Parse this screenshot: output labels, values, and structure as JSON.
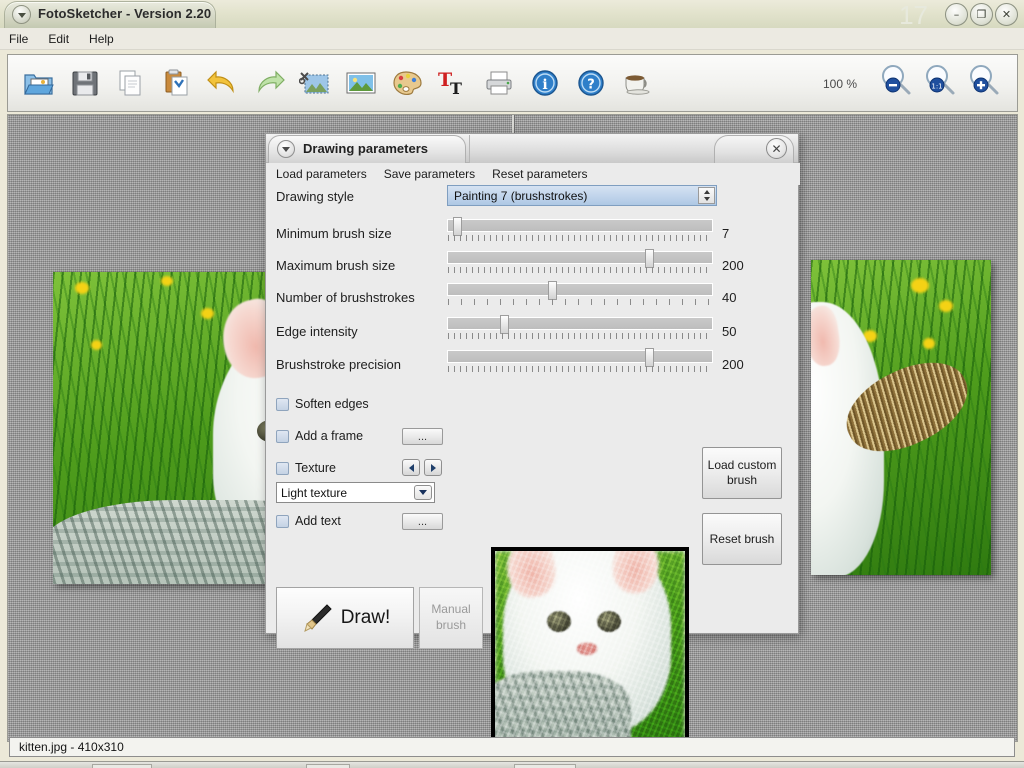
{
  "window": {
    "title": "FotoSketcher - Version 2.20",
    "bg_window_number": "17",
    "controls": {
      "minimize": "–",
      "maximize": "❐",
      "close": "✕"
    },
    "dropdown_icon": "chevron-down-icon"
  },
  "menubar": {
    "items": [
      "File",
      "Edit",
      "Help"
    ]
  },
  "toolbar": {
    "icons": [
      "open-folder-icon",
      "save-icon",
      "copy-icon",
      "paste-icon",
      "undo-icon",
      "redo-icon",
      "crop-icon",
      "image-icon",
      "palette-icon",
      "text-icon",
      "print-icon",
      "info-icon",
      "help-icon",
      "coffee-icon"
    ],
    "zoom_level": "100 %",
    "zoom_out_icon": "zoom-out-icon",
    "zoom_fit_icon": "zoom-fit-icon",
    "zoom_in_icon": "zoom-in-icon"
  },
  "dialog": {
    "title": "Drawing parameters",
    "close_label": "✕",
    "menu": [
      "Load parameters",
      "Save parameters",
      "Reset parameters"
    ],
    "style_row": {
      "label": "Drawing style",
      "value": "Painting 7 (brushstrokes)"
    },
    "sliders": [
      {
        "label": "Minimum brush size",
        "value": "7",
        "pos_pct": 3
      },
      {
        "label": "Maximum brush size",
        "value": "200",
        "pos_pct": 76
      },
      {
        "label": "Number of brushstrokes",
        "value": "40",
        "pos_pct": 39
      },
      {
        "label": "Edge intensity",
        "value": "50",
        "pos_pct": 20
      },
      {
        "label": "Brushstroke precision",
        "value": "200",
        "pos_pct": 76
      }
    ],
    "checkboxes": [
      {
        "label": "Soften edges",
        "checked": false
      },
      {
        "label": "Add a frame",
        "checked": false,
        "button": "..."
      },
      {
        "label": "Texture",
        "checked": false
      },
      {
        "label": "Add text",
        "checked": false,
        "button": "..."
      }
    ],
    "texture_select": {
      "value": "Light texture"
    },
    "texture_prev_icon": "arrow-left-icon",
    "texture_next_icon": "arrow-right-icon",
    "draw_button": {
      "label": "Draw!",
      "icon": "brush-icon"
    },
    "manual_brush_button": {
      "label": "Manual brush",
      "enabled": false
    },
    "load_custom_brush_button": {
      "label": "Load custom brush"
    },
    "reset_brush_button": {
      "label": "Reset brush"
    },
    "preview": {
      "name": "painting-preview"
    }
  },
  "statusbar": {
    "text": "kitten.jpg - 410x310"
  },
  "colors": {
    "accent": "#1f3f6b",
    "combo_blue": "#c2d5ec",
    "canvas_gray": "#9a9a9a",
    "dialog_bg": "#ebebeb",
    "title_green": "#b9c6a4"
  }
}
